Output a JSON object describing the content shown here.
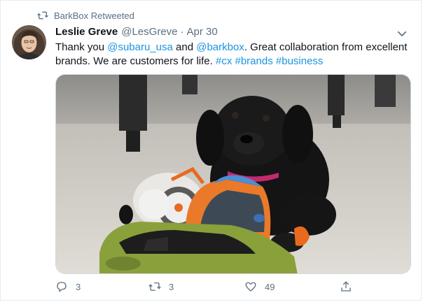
{
  "social_context": {
    "icon": "retweet-icon",
    "text": "BarkBox Retweeted"
  },
  "author": {
    "name": "Leslie Greve",
    "handle": "@LesGreve",
    "separator": "·",
    "date": "Apr 30"
  },
  "tweet": {
    "segments": [
      {
        "text": "Thank you ",
        "link": false
      },
      {
        "text": "@subaru_usa",
        "link": true
      },
      {
        "text": " and ",
        "link": false
      },
      {
        "text": "@barkbox",
        "link": true
      },
      {
        "text": ". Great collaboration from excellent brands. We are customers for life. ",
        "link": false
      },
      {
        "text": "#cx",
        "link": true
      },
      {
        "text": " ",
        "link": false
      },
      {
        "text": "#brands",
        "link": true
      },
      {
        "text": " ",
        "link": false
      },
      {
        "text": "#business",
        "link": true
      }
    ]
  },
  "actions": {
    "reply": {
      "icon": "reply-icon",
      "count": "3"
    },
    "retweet": {
      "icon": "retweet-icon",
      "count": "3"
    },
    "like": {
      "icon": "heart-icon",
      "count": "49"
    },
    "share": {
      "icon": "share-icon"
    }
  },
  "colors": {
    "link": "#1b95e0",
    "muted": "#5b7083",
    "text": "#0f1419"
  }
}
